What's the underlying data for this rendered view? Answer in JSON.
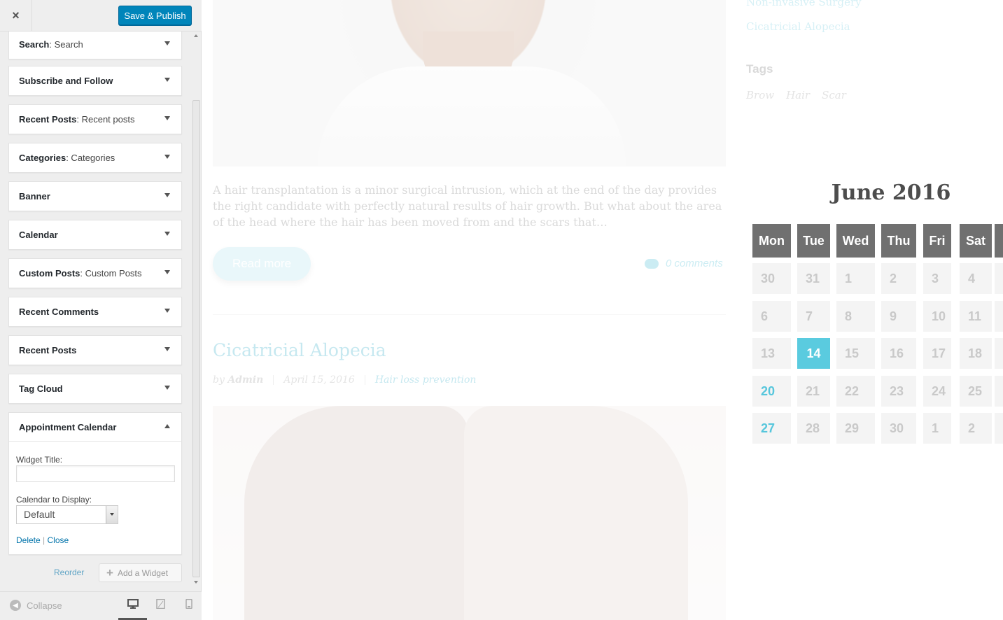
{
  "header": {
    "close_icon": "×",
    "publish_label": "Save & Publish"
  },
  "widgets": [
    {
      "title": "Search",
      "subtitle": ": Search"
    },
    {
      "title": "Subscribe and Follow",
      "subtitle": ""
    },
    {
      "title": "Recent Posts",
      "subtitle": ": Recent posts"
    },
    {
      "title": "Categories",
      "subtitle": ": Categories"
    },
    {
      "title": "Banner",
      "subtitle": ""
    },
    {
      "title": "Calendar",
      "subtitle": ""
    },
    {
      "title": "Custom Posts",
      "subtitle": ": Custom Posts"
    },
    {
      "title": "Recent Comments",
      "subtitle": ""
    },
    {
      "title": "Recent Posts",
      "subtitle": ""
    },
    {
      "title": "Tag Cloud",
      "subtitle": ""
    }
  ],
  "expanded_widget": {
    "title": "Appointment Calendar",
    "widget_title_label": "Widget Title:",
    "widget_title_value": "",
    "calendar_label": "Calendar to Display:",
    "calendar_value": "Default",
    "delete_label": "Delete",
    "separator": "|",
    "close_label": "Close"
  },
  "footer": {
    "reorder_label": "Reorder",
    "add_widget_label": "Add a Widget",
    "collapse_label": "Collapse",
    "devices": [
      "desktop-icon",
      "tablet-icon",
      "mobile-icon"
    ]
  },
  "preview": {
    "excerpt": "A hair transplantation is a minor surgical intrusion, which at the end of the day provides the right candidate with perfectly natural results of hair growth. But what about  the area of the head where the hair has been moved from and the scars that…",
    "read_more": "Read more",
    "comments": "0 comments",
    "post_title": "Cicatricial Alopecia",
    "meta_by": "by",
    "meta_author": "Admin",
    "meta_date": "April 15, 2016",
    "meta_category": "Hair loss prevention",
    "sidebar_link1": "Non-invasive Surgery",
    "sidebar_link2": "Cicatricial Alopecia",
    "tags_heading": "Tags",
    "tags": [
      "Brow",
      "Hair",
      "Scar"
    ]
  },
  "calendar": {
    "title": "June 2016",
    "days": [
      "Mon",
      "Tue",
      "Wed",
      "Thu",
      "Fri",
      "Sat"
    ],
    "weeks": [
      [
        "30",
        "31",
        "1",
        "2",
        "3",
        "4"
      ],
      [
        "6",
        "7",
        "8",
        "9",
        "10",
        "11"
      ],
      [
        "13",
        "14",
        "15",
        "16",
        "17",
        "18"
      ],
      [
        "20",
        "21",
        "22",
        "23",
        "24",
        "25"
      ],
      [
        "27",
        "28",
        "29",
        "30",
        "1",
        "2"
      ]
    ],
    "today": "14",
    "available": [
      "20",
      "27"
    ],
    "colors": {
      "header": "#707070",
      "today": "#5acbdf",
      "available": "#56c6dc"
    }
  }
}
